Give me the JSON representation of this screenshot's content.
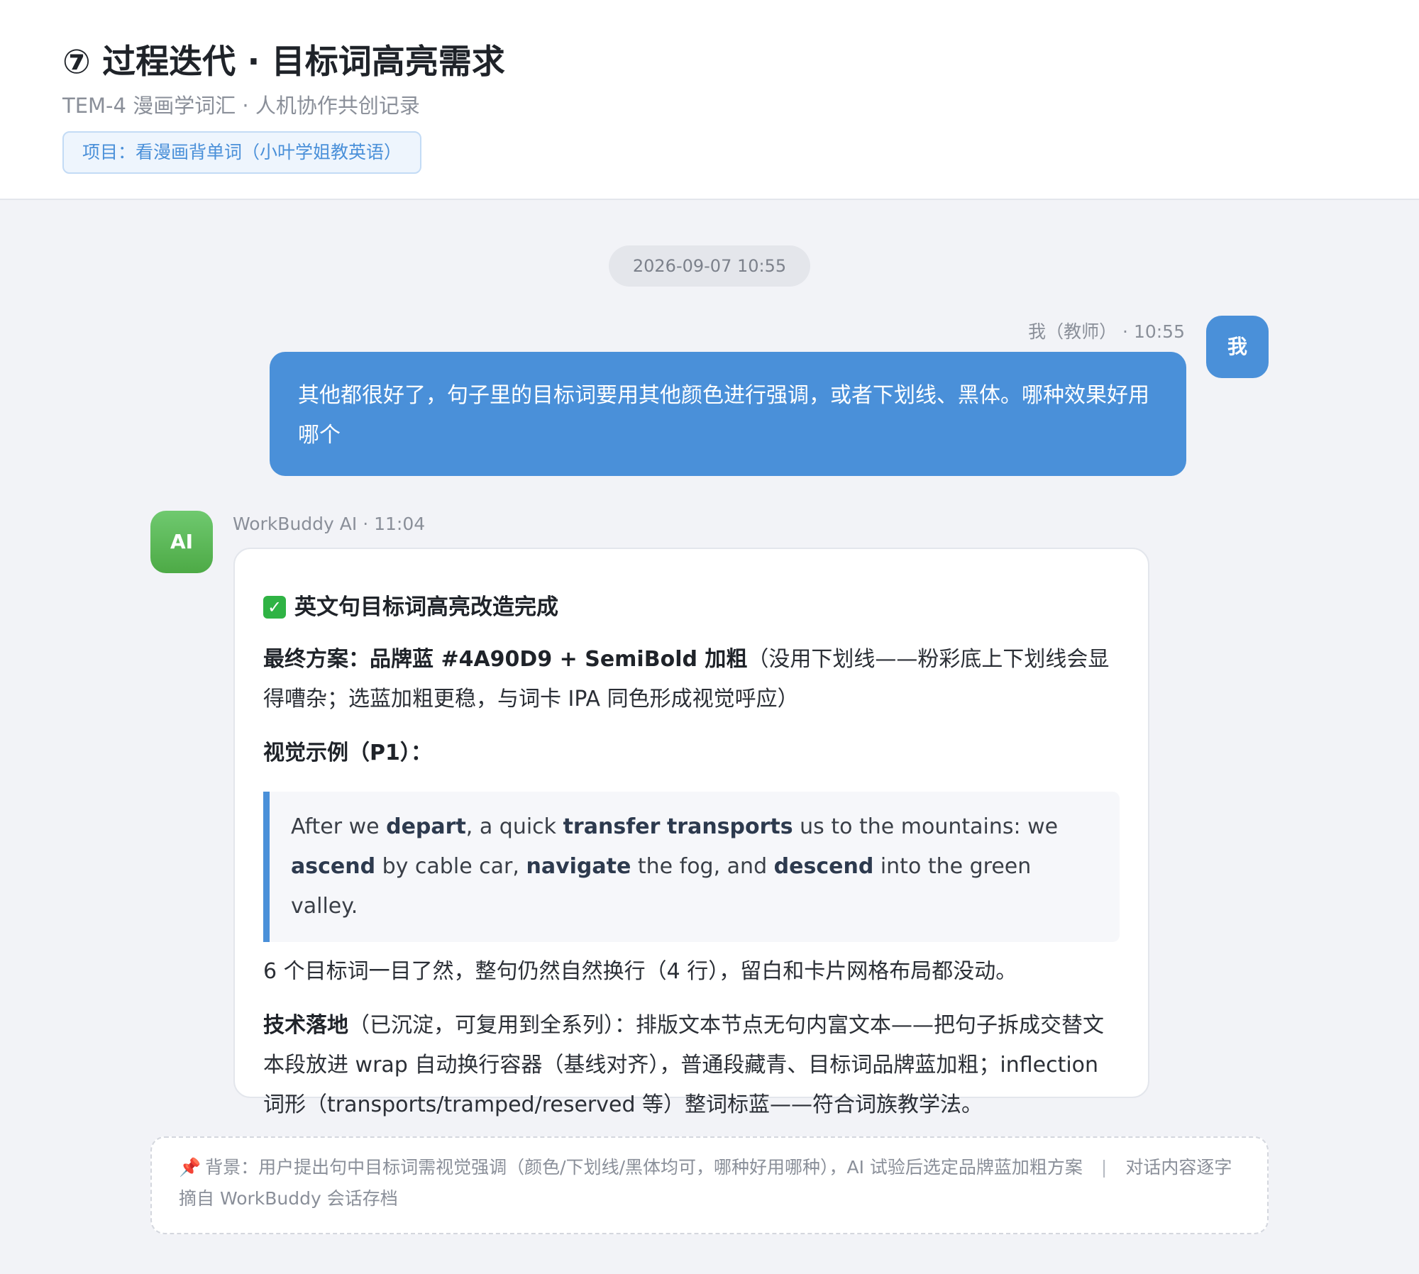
{
  "header": {
    "title": "⑦ 过程迭代 · 目标词高亮需求",
    "subtitle": "TEM-4 漫画学词汇 · 人机协作共创记录",
    "project_tag": "项目：看漫画背单词（小叶学姐教英语）"
  },
  "timestamp": "2026-09-07 10:55",
  "user_message": {
    "meta": "我（教师） · 10:55",
    "avatar_text": "我",
    "text": "其他都很好了，句子里的目标词要用其他颜色进行强调，或者下划线、黑体。哪种效果好用哪个"
  },
  "ai_message": {
    "meta": "WorkBuddy AI · 11:04",
    "avatar_text": "AI",
    "heading": "英文句目标词高亮改造完成",
    "final_label": "最终方案：",
    "final_value": "品牌蓝 #4A90D9 + SemiBold 加粗",
    "final_note": "（没用下划线——粉彩底上下划线会显得嘈杂；选蓝加粗更稳，与词卡 IPA 同色形成视觉呼应）",
    "example_label": "视觉示例（P1）：",
    "example_sentence": {
      "s1": "After we ",
      "w1": "depart",
      "s2": ", a quick ",
      "w2": "transfer",
      "s3": " ",
      "w3": "transports",
      "s4": " us to the mountains: we ",
      "w4": "ascend",
      "s5": " by cable car, ",
      "w5": "navigate",
      "s6": " the fog, and ",
      "w6": "descend",
      "s7": " into the green valley."
    },
    "summary": "6 个目标词一目了然，整句仍然自然换行（4 行），留白和卡片网格布局都没动。",
    "tech_label": "技术落地",
    "tech_text": "（已沉淀，可复用到全系列）：排版文本节点无句内富文本——把句子拆成交替文本段放进 wrap 自动换行容器（基线对齐），普通段藏青、目标词品牌蓝加粗；inflection 词形（transports/tramped/reserved 等）整词标蓝——符合词族教学法。"
  },
  "footer": {
    "background": "背景：用户提出句中目标词需视觉强调（颜色/下划线/黑体均可，哪种好用哪种），AI 试验后选定品牌蓝加粗方案",
    "separator": "|",
    "source": "对话内容逐字摘自 WorkBuddy 会话存档"
  },
  "colors": {
    "brand_blue": "#4A90D9",
    "ai_green": "#4DAA46",
    "background": "#F2F3F7"
  }
}
